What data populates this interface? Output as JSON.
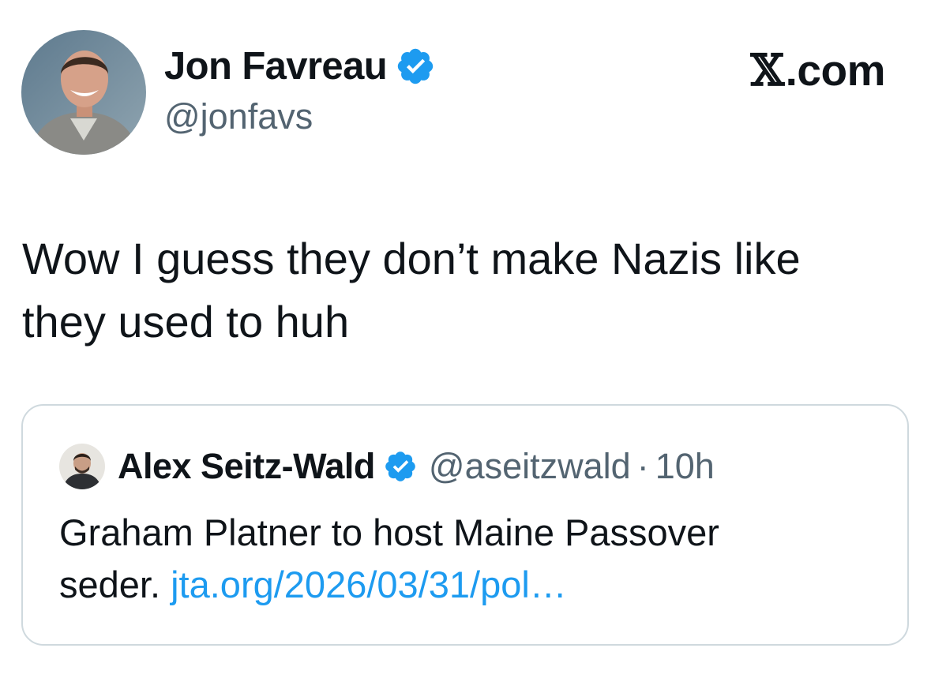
{
  "author": {
    "display_name": "Jon Favreau",
    "handle": "@jonfavs",
    "avatar_icon": "profile-photo",
    "verified": true
  },
  "brand": {
    "label": ".com",
    "logo_glyph": "𝕏",
    "icon": "x-logo-icon"
  },
  "tweet": {
    "text_line1": "Wow I guess they don’t make Nazis like",
    "text_line2": "they used to huh"
  },
  "quote": {
    "display_name": "Alex Seitz-Wald",
    "handle": "@aseitzwald",
    "separator": "·",
    "time": "10h",
    "verified": true,
    "text_line1": "Graham Platner to host Maine Passover",
    "text_line2_prefix": "seder.",
    "link_text": "jta.org/2026/03/31/pol…"
  },
  "colors": {
    "verified_blue": "#1d9bf0",
    "link_blue": "#1d9bf0",
    "secondary_text": "#536471",
    "border": "#cfd9de"
  }
}
